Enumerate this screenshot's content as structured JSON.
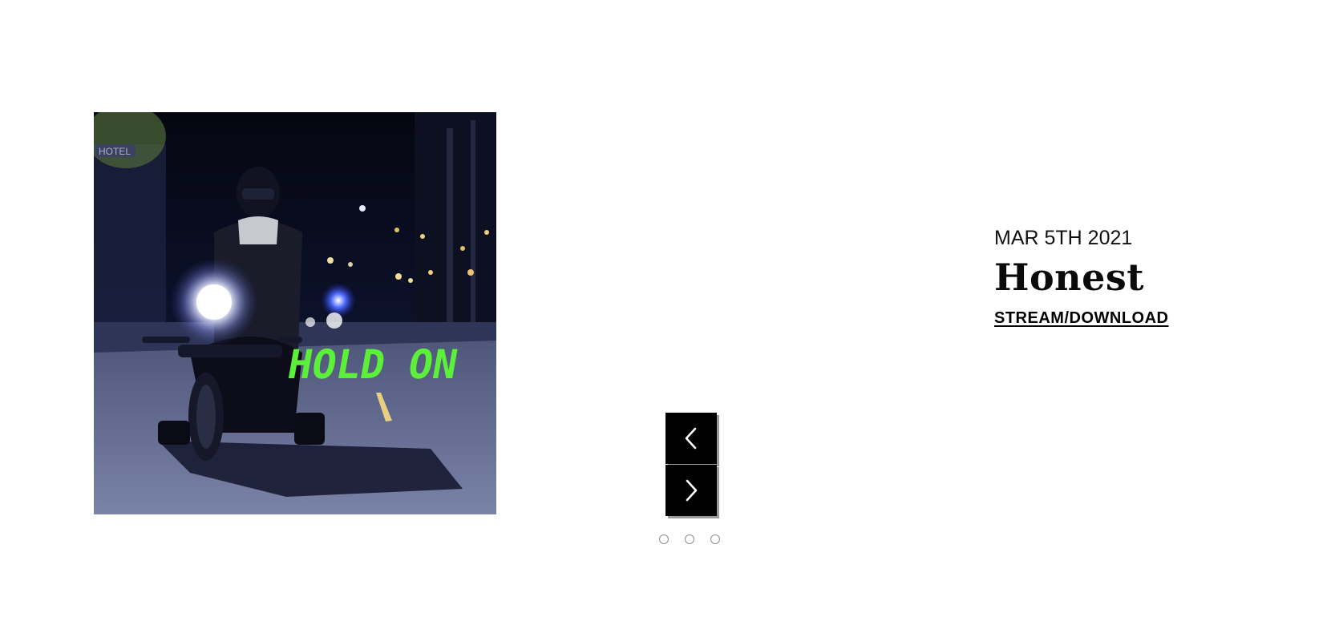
{
  "slider": {
    "cover": {
      "graffiti_text": "HOLD ON",
      "graffiti_color": "#5cf03a",
      "sign_text": "HOTEL"
    },
    "controls": {
      "prev_icon": "chevron-left-icon",
      "next_icon": "chevron-right-icon",
      "dot_count": 3
    }
  },
  "release": {
    "date": "MAR 5TH 2021",
    "title": "Honest",
    "link_label": "STREAM/DOWNLOAD"
  },
  "colors": {
    "background": "#ffffff",
    "button": "#000000",
    "text": "#111111"
  }
}
